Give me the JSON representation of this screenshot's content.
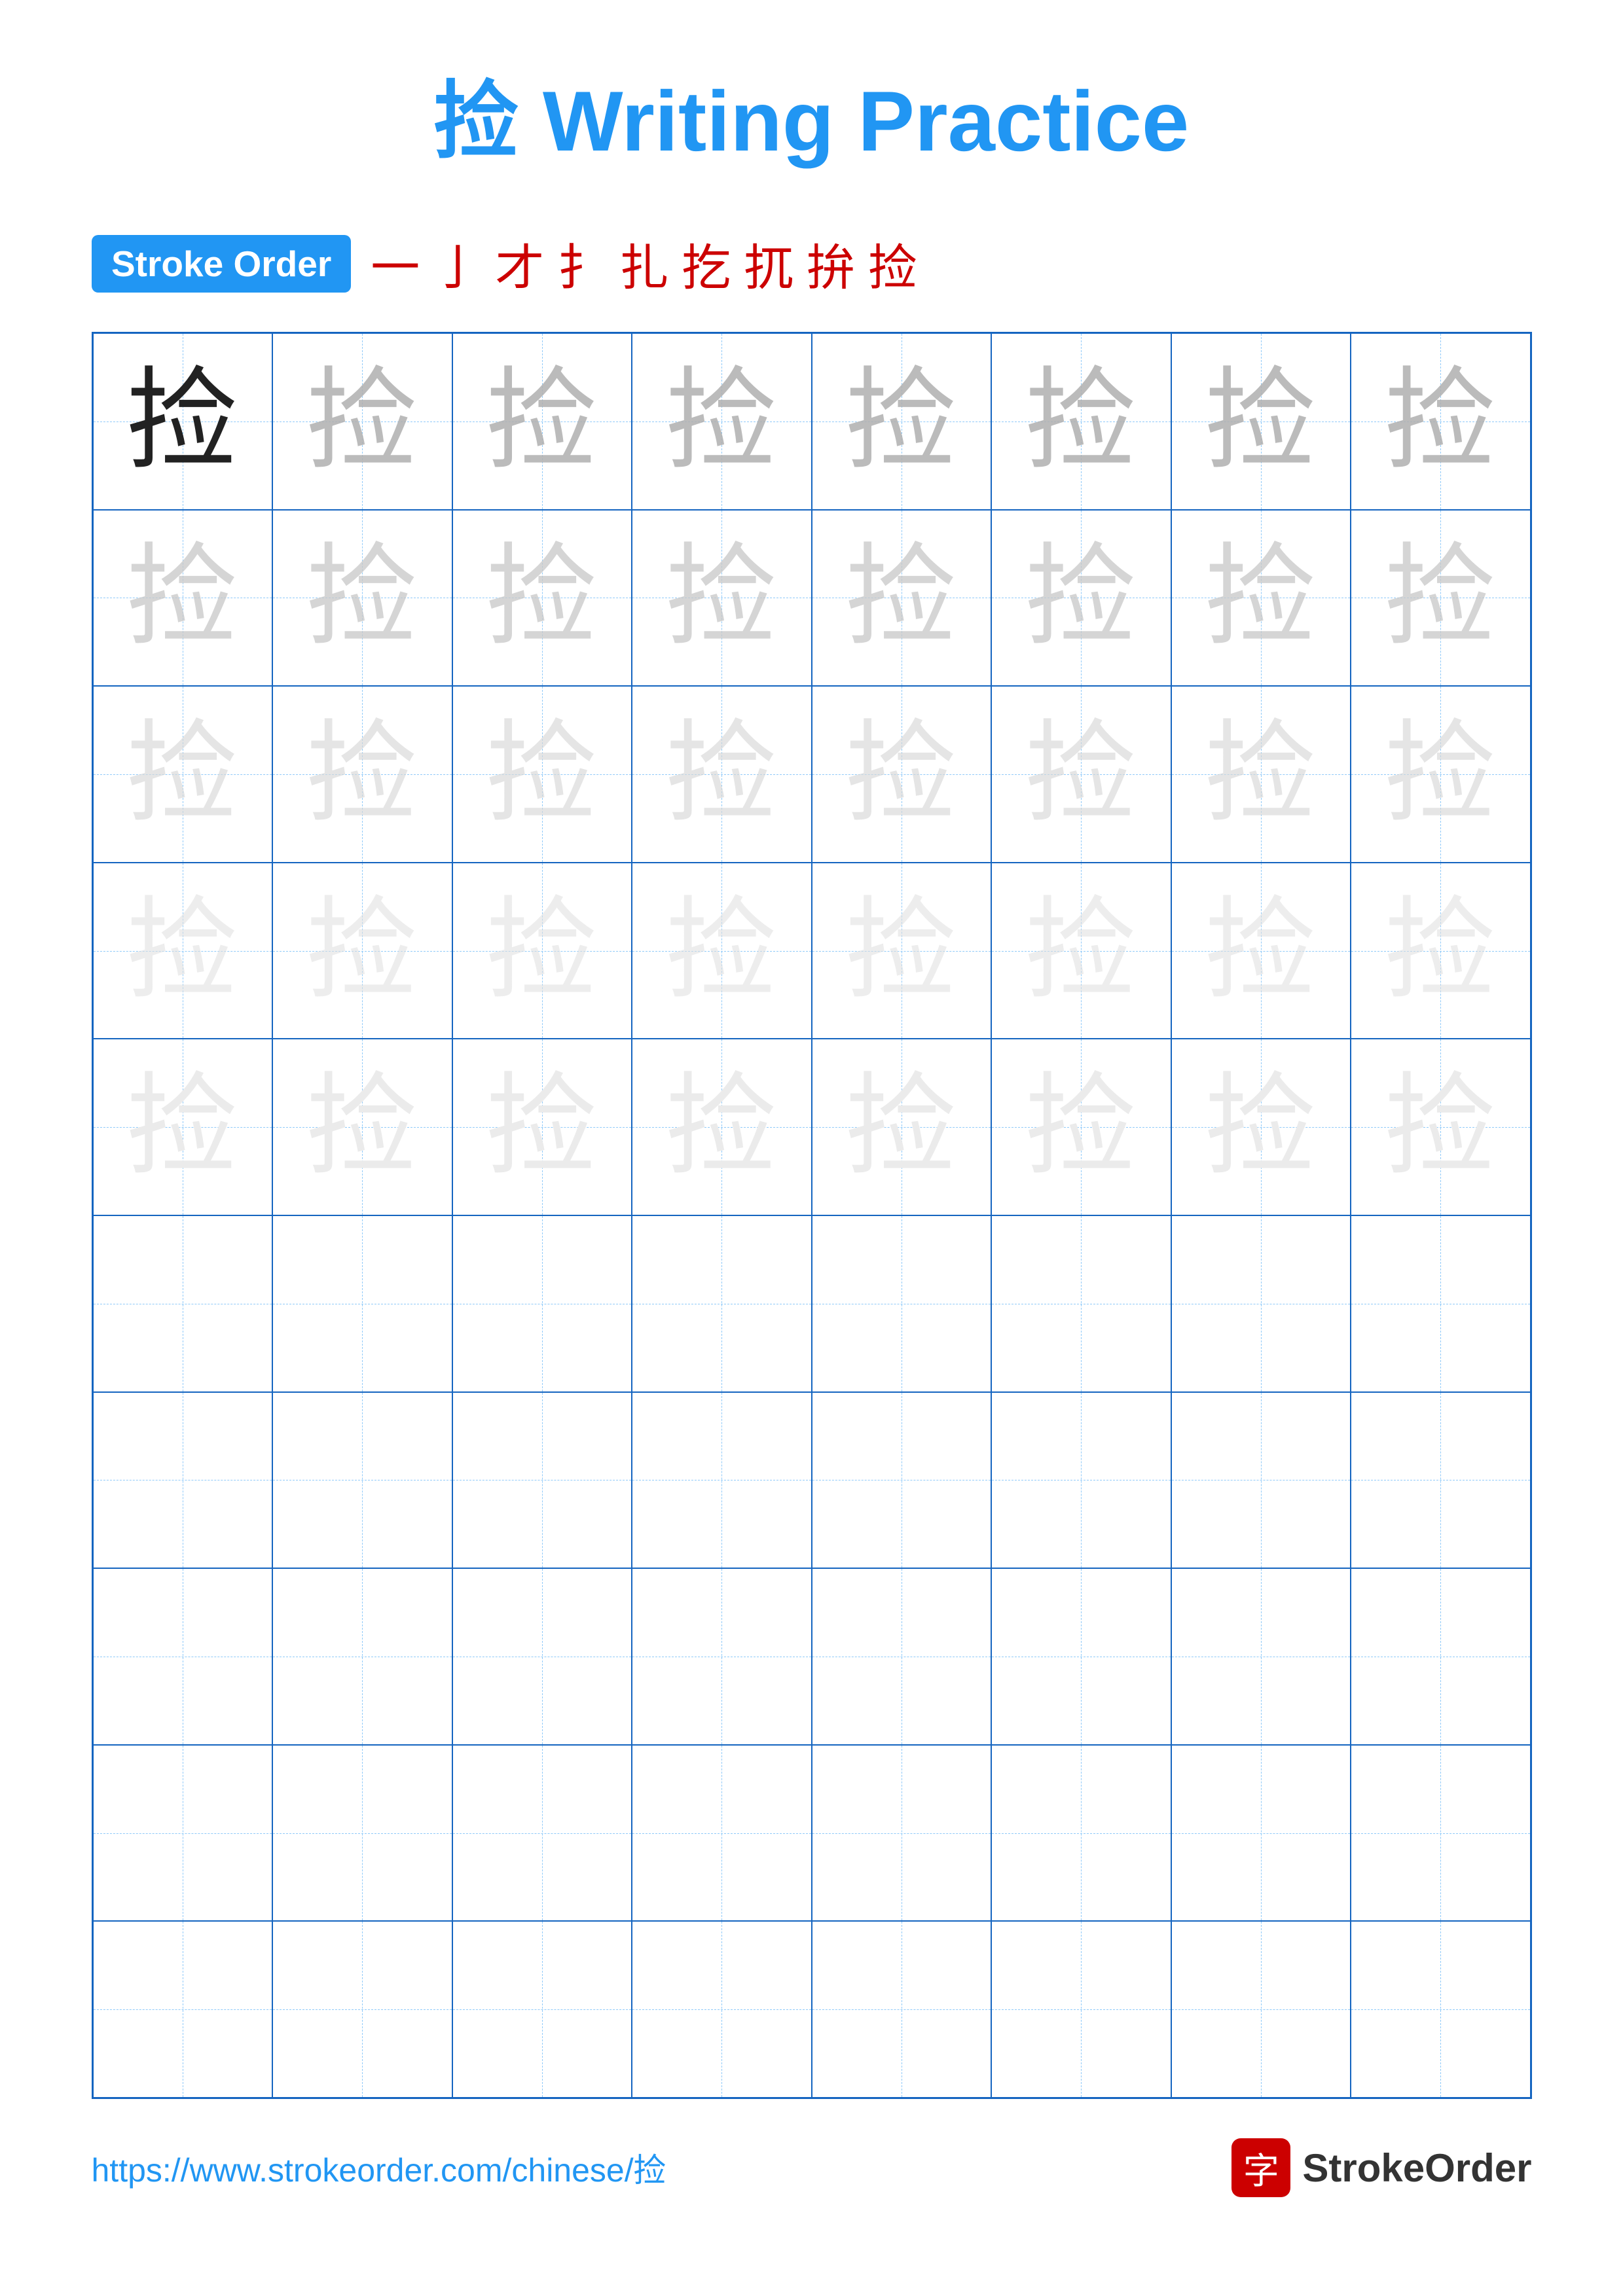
{
  "title": "捡 Writing Practice",
  "stroke_order_badge": "Stroke Order",
  "stroke_sequence": [
    "⼀",
    "亅",
    "才",
    "扌",
    "扎",
    "扢",
    "扤",
    "拚",
    "捡"
  ],
  "character": "捡",
  "grid": {
    "cols": 8,
    "rows": 10,
    "char_rows": 5
  },
  "footer": {
    "url": "https://www.strokeorder.com/chinese/捡",
    "logo_char": "字",
    "logo_text": "StrokeOrder"
  }
}
